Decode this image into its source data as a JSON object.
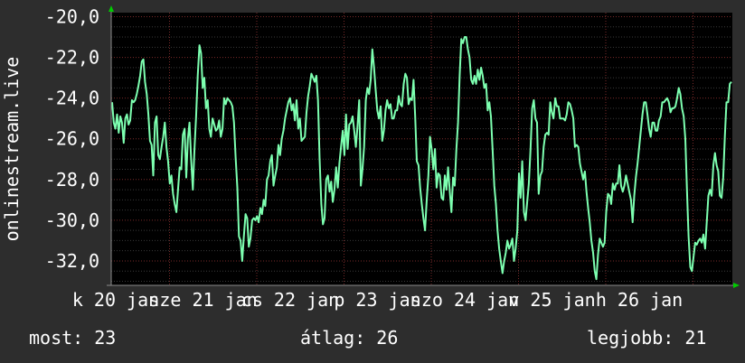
{
  "chart_data": {
    "type": "line",
    "ylabel": "onlinestream.live",
    "ylim": [
      -33.2,
      -19.8
    ],
    "y_ticks": [
      "-20,0",
      "-22,0",
      "-24,0",
      "-26,0",
      "-28,0",
      "-30,0",
      "-32,0"
    ],
    "y_tick_values": [
      -20,
      -22,
      -24,
      -26,
      -28,
      -30,
      -32
    ],
    "x_ticks": [
      "k 20 jan",
      "sze 21 jan",
      "cs 22 jan",
      "p 23 jan",
      "szo 24 jan",
      "v 25 jan",
      "h 26 jan"
    ],
    "grid": true,
    "line_color": "#7dffb0",
    "series": [
      {
        "values": [
          -24.2,
          -25.2,
          -25.5,
          -24.8,
          -25.7,
          -24.9,
          -25.2,
          -26.2,
          -25.0,
          -24.8,
          -25.3,
          -25.1,
          -24.1,
          -24.2,
          -24.1,
          -23.8,
          -23.4,
          -22.9,
          -22.2,
          -22.1,
          -23.2,
          -23.8,
          -24.8,
          -26.1,
          -26.3,
          -27.8,
          -25.2,
          -24.9,
          -26.8,
          -27.0,
          -26.4,
          -25.9,
          -25.2,
          -26.4,
          -27.1,
          -28.2,
          -27.8,
          -28.7,
          -29.2,
          -29.6,
          -28.5,
          -27.4,
          -27.5,
          -25.8,
          -25.5,
          -27.9,
          -26.0,
          -25.2,
          -27.0,
          -28.5,
          -26.5,
          -24.9,
          -22.9,
          -21.4,
          -21.8,
          -23.5,
          -23.0,
          -24.5,
          -24.1,
          -25.5,
          -25.9,
          -25.0,
          -25.3,
          -25.6,
          -25.5,
          -25.1,
          -25.9,
          -25.5,
          -24.0,
          -24.3,
          -24.0,
          -24.1,
          -24.2,
          -24.4,
          -25.2,
          -26.9,
          -28.4,
          -30.8,
          -31.0,
          -32.0,
          -30.8,
          -29.7,
          -29.9,
          -31.3,
          -30.9,
          -30.0,
          -29.9,
          -30.0,
          -29.8,
          -30.1,
          -29.4,
          -29.7,
          -29.0,
          -29.3,
          -28.0,
          -27.8,
          -27.1,
          -26.8,
          -28.3,
          -27.8,
          -27.4,
          -26.3,
          -26.8,
          -26.0,
          -25.6,
          -25.0,
          -24.6,
          -24.2,
          -24.0,
          -24.6,
          -24.3,
          -25.1,
          -24.1,
          -25.5,
          -25.0,
          -26.1,
          -26.0,
          -25.9,
          -24.7,
          -23.9,
          -23.4,
          -22.8,
          -23.0,
          -23.2,
          -22.9,
          -24.1,
          -27.0,
          -29.2,
          -30.2,
          -29.9,
          -28.0,
          -27.8,
          -28.6,
          -28.1,
          -29.1,
          -28.5,
          -27.4,
          -28.4,
          -27.2,
          -26.4,
          -25.6,
          -26.8,
          -24.8,
          -26.5,
          -25.3,
          -25.2,
          -24.9,
          -25.6,
          -26.4,
          -25.4,
          -24.1,
          -28.3,
          -27.5,
          -26.4,
          -24.1,
          -23.5,
          -23.8,
          -23.1,
          -21.6,
          -22.5,
          -23.6,
          -24.6,
          -25.0,
          -24.4,
          -26.1,
          -25.6,
          -24.6,
          -24.1,
          -24.5,
          -24.3,
          -25.0,
          -25.0,
          -24.6,
          -24.6,
          -23.9,
          -24.3,
          -24.4,
          -23.3,
          -22.8,
          -23.0,
          -24.3,
          -24.0,
          -24.1,
          -23.1,
          -24.9,
          -27.1,
          -27.3,
          -28.4,
          -29.2,
          -29.9,
          -30.5,
          -29.0,
          -27.8,
          -25.9,
          -26.5,
          -27.5,
          -26.5,
          -28.4,
          -27.7,
          -27.8,
          -28.9,
          -29.0,
          -27.8,
          -28.5,
          -27.4,
          -28.6,
          -29.6,
          -27.9,
          -28.3,
          -26.5,
          -25.2,
          -22.9,
          -21.1,
          -21.3,
          -21.0,
          -21.0,
          -21.6,
          -22.0,
          -23.1,
          -23.3,
          -22.9,
          -23.3,
          -22.6,
          -23.1,
          -22.5,
          -22.9,
          -23.5,
          -23.3,
          -24.6,
          -24.2,
          -24.9,
          -26.5,
          -28.3,
          -29.2,
          -30.5,
          -31.4,
          -32.0,
          -32.6,
          -32.0,
          -31.6,
          -31.0,
          -31.4,
          -31.2,
          -30.9,
          -32.0,
          -31.4,
          -30.5,
          -27.7,
          -28.9,
          -27.1,
          -29.6,
          -30.0,
          -29.1,
          -28.2,
          -26.6,
          -24.5,
          -24.1,
          -25.0,
          -25.2,
          -28.7,
          -27.8,
          -27.6,
          -26.4,
          -25.8,
          -25.7,
          -25.8,
          -24.2,
          -24.7,
          -25.0,
          -24.0,
          -24.4,
          -24.4,
          -25.0,
          -25.0,
          -25.0,
          -25.1,
          -24.8,
          -24.2,
          -24.3,
          -24.6,
          -25.0,
          -26.4,
          -26.3,
          -26.4,
          -27.2,
          -27.6,
          -28.0,
          -27.6,
          -28.6,
          -29.4,
          -30.1,
          -31.0,
          -31.6,
          -32.5,
          -32.9,
          -31.7,
          -30.9,
          -31.1,
          -31.3,
          -31.1,
          -29.6,
          -28.7,
          -28.8,
          -29.2,
          -28.2,
          -28.5,
          -28.2,
          -28.2,
          -27.3,
          -28.3,
          -28.6,
          -28.3,
          -27.8,
          -28.2,
          -28.6,
          -29.0,
          -30.1,
          -28.8,
          -27.9,
          -27.2,
          -26.4,
          -25.6,
          -24.8,
          -24.2,
          -24.2,
          -24.8,
          -25.5,
          -25.9,
          -25.2,
          -25.2,
          -25.6,
          -25.6,
          -25.1,
          -24.9,
          -24.2,
          -24.2,
          -24.1,
          -24.0,
          -24.2,
          -24.7,
          -24.5,
          -24.5,
          -24.4,
          -24.0,
          -23.5,
          -23.8,
          -24.5,
          -24.9,
          -26.0,
          -28.5,
          -30.8,
          -32.3,
          -32.5,
          -31.8,
          -31.1,
          -31.2,
          -31.0,
          -30.9,
          -31.1,
          -30.7,
          -31.4,
          -30.1,
          -28.8,
          -28.5,
          -28.8,
          -27.3,
          -26.7,
          -27.3,
          -27.6,
          -28.8,
          -28.9,
          -27.9,
          -25.9,
          -24.2,
          -24.2,
          -23.3,
          -23.2
        ]
      }
    ]
  },
  "footer": {
    "now": "most: 23",
    "avg": "átlag: 26",
    "best": "legjobb: 21"
  }
}
